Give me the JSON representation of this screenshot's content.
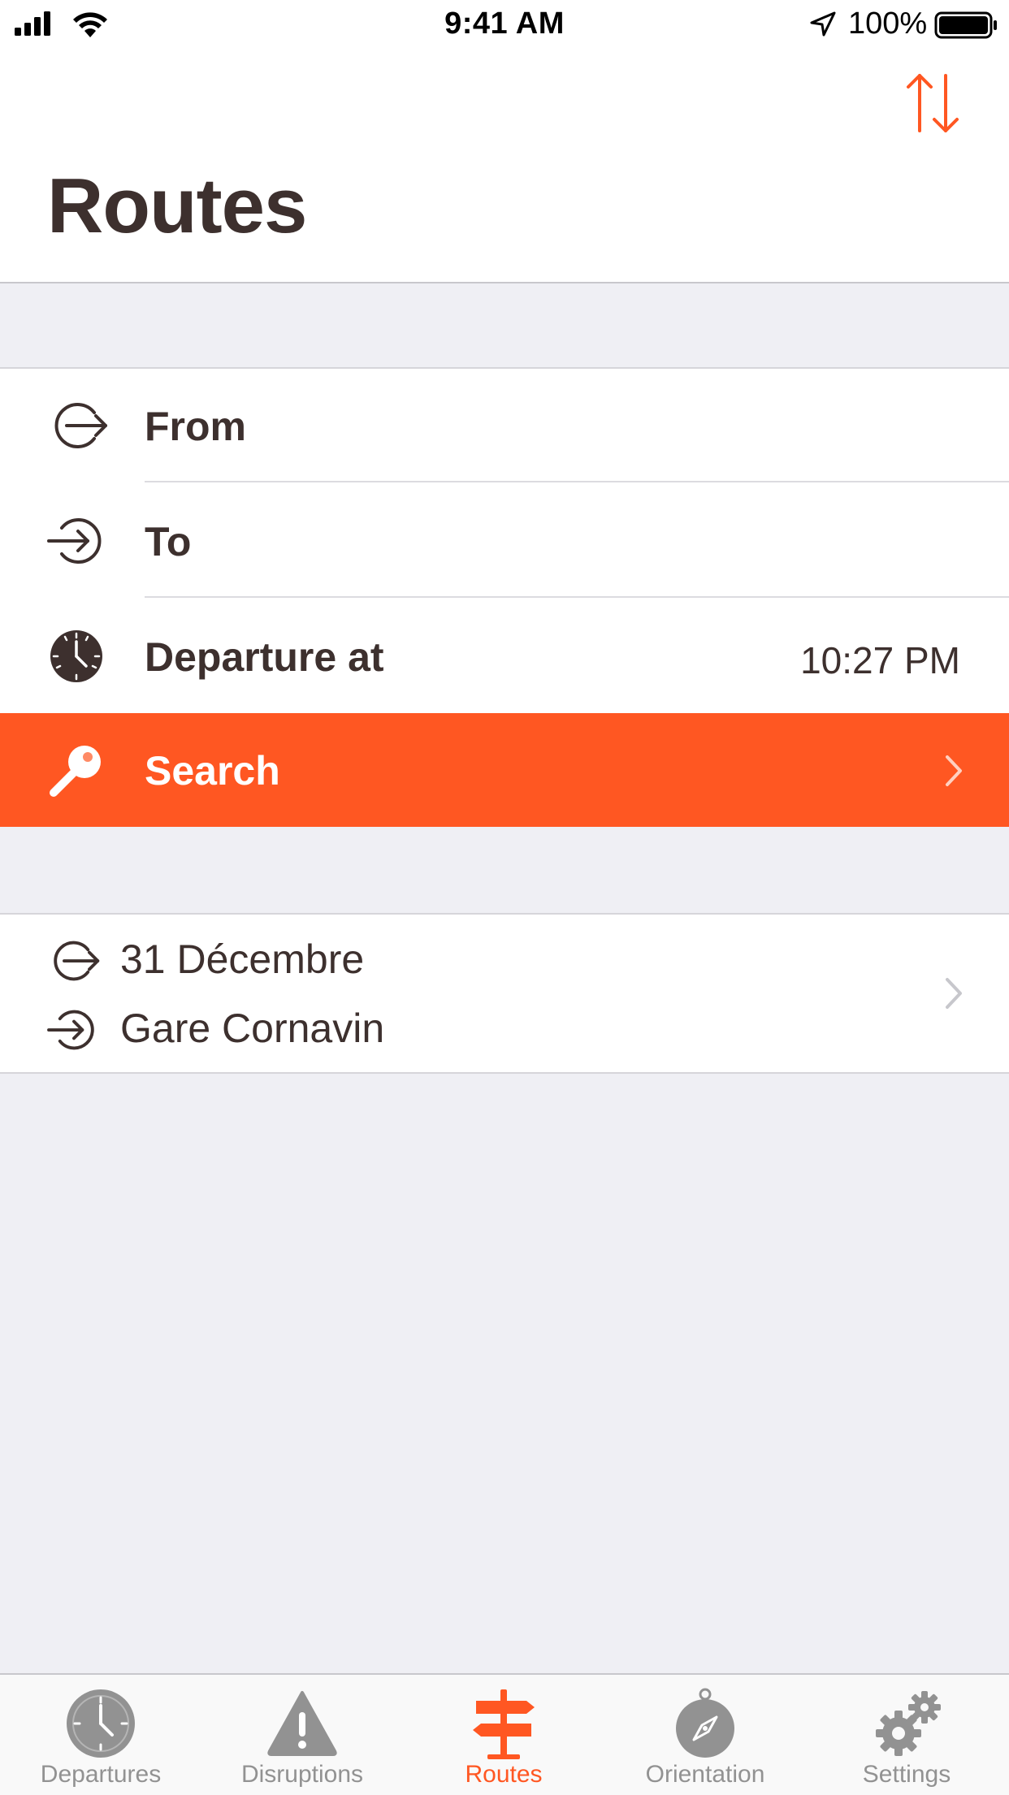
{
  "status_bar": {
    "time": "9:41 AM",
    "battery_percent": "100%",
    "signal_bars": 4,
    "icons": [
      "signal-icon",
      "wifi-icon",
      "location-arrow-icon",
      "battery-icon"
    ]
  },
  "header": {
    "title": "Routes",
    "swap_icon": "swap-vertical-arrows-icon"
  },
  "form": {
    "from_label": "From",
    "to_label": "To",
    "departure_label": "Departure at",
    "departure_time": "10:27 PM",
    "search_label": "Search",
    "icons": [
      "departure-exit-icon",
      "arrival-enter-icon",
      "clock-icon",
      "magnifier-icon",
      "chevron-right-icon"
    ]
  },
  "recent": {
    "from": "31 Décembre",
    "to": "Gare Cornavin"
  },
  "tabs": [
    {
      "label": "Departures",
      "icon": "clock-icon",
      "active": false
    },
    {
      "label": "Disruptions",
      "icon": "warning-icon",
      "active": false
    },
    {
      "label": "Routes",
      "icon": "signpost-icon",
      "active": true
    },
    {
      "label": "Orientation",
      "icon": "compass-icon",
      "active": false
    },
    {
      "label": "Settings",
      "icon": "gears-icon",
      "active": false
    }
  ],
  "colors": {
    "accent": "#ff5722",
    "text": "#3d302e",
    "background": "#efeff4",
    "tab_inactive": "#929292"
  }
}
